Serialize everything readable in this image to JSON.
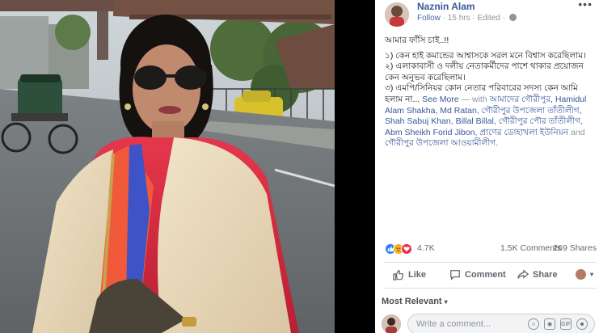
{
  "post": {
    "author": "Naznin Alam",
    "follow": "Follow",
    "time": "15 hrs",
    "edited": "Edited",
    "more_glyph": "•••",
    "intro": "আমার ফাঁসি চাই..!!",
    "lines": [
      "১) কেন হাই কমান্ডের আশ্বাসকে সরল মনে বিশ্বাস করেছিলাম।",
      "২) এলাকাবাসী ও দলীয় নেতাকর্মীদের পাশে থাকার প্রয়োজন কেন অনুভব করেছিলাম।",
      "৩) এমপি/সিনিয়র কোন নেতার পরিবারের সদস্য কেন আমি হলাম না..."
    ],
    "see_more": "See More",
    "with_word": "— with",
    "tagged": [
      "আমাদের গৌরীপুর,",
      "Hamidul Alam Shakha,",
      "Md Ratan,",
      "গৌরীপুর উপজেলা তাঁতীলীগ,",
      "Shah Sabuj Khan,",
      "Billal Billal,",
      "গৌরীপুর পৌর তাঁতীলীগ,",
      "Abm Sheikh Forid Jibon,",
      "প্রাণের ডোহাখলা ইউনিয়ন"
    ],
    "and_word": "and",
    "last_tag": "গৌরীপুর উপজেলা আওয়ামীলীগ."
  },
  "stats": {
    "reactions": "4.7K",
    "comments": "1.5K Comments",
    "shares": "269 Shares"
  },
  "actions": {
    "like": "Like",
    "comment": "Comment",
    "share": "Share"
  },
  "sort": {
    "label": "Most Relevant",
    "caret": "▾"
  },
  "composer": {
    "placeholder": "Write a comment...",
    "gif": "GIF"
  },
  "colors": {
    "link": "#385898",
    "like_blue": "#2e7bf6",
    "love_red": "#f0284a",
    "sad_yellow": "#f7b125"
  },
  "icons": [
    "globe-icon",
    "like-icon",
    "comment-icon",
    "share-icon",
    "emoji-icon",
    "camera-icon",
    "gif-icon",
    "sticker-icon"
  ]
}
